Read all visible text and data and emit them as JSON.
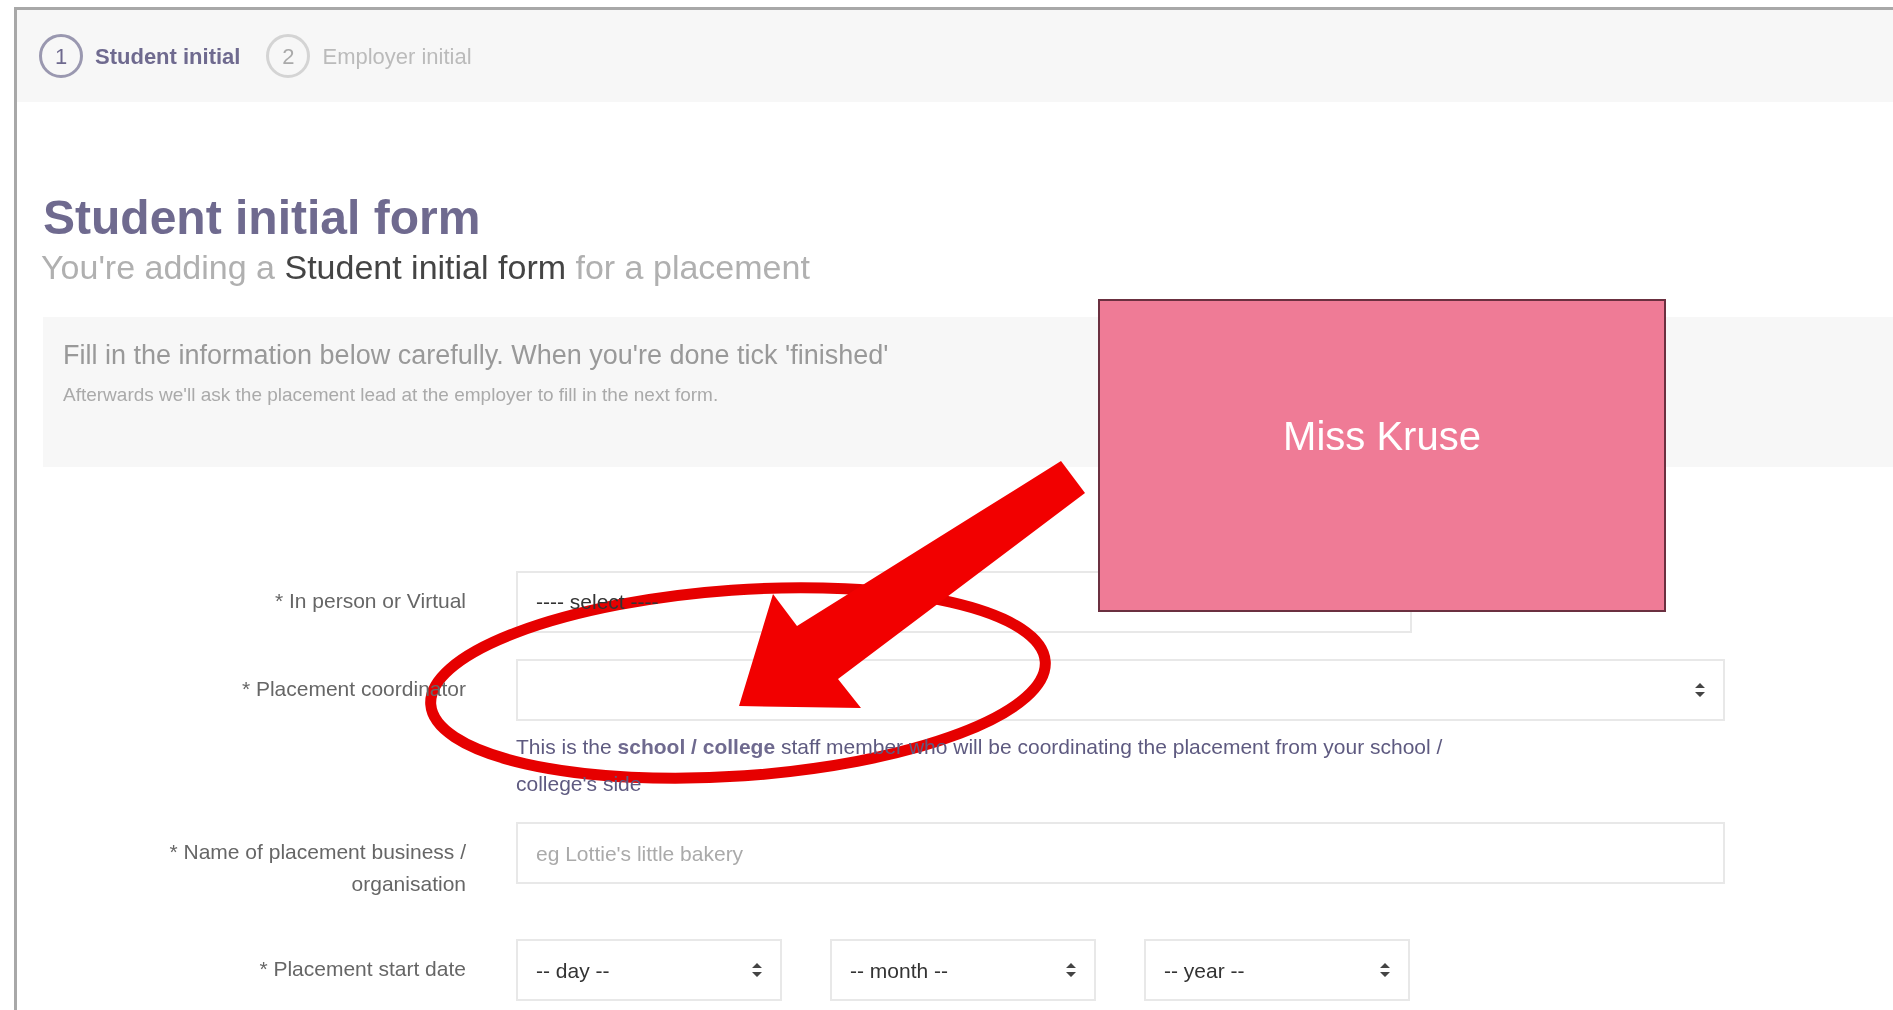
{
  "steps": [
    {
      "number": "1",
      "label": "Student initial",
      "selected": true
    },
    {
      "number": "2",
      "label": "Employer initial",
      "selected": false
    }
  ],
  "heading": "Student initial form",
  "subtitle": {
    "before": "You're adding a",
    "emphasis": "Student initial form",
    "after": "for a placement"
  },
  "info": {
    "main": "Fill in the information below carefully. When you're done tick 'finished'",
    "note": "Afterwards we'll ask the placement lead at the employer to fill in the next form."
  },
  "fields": [
    {
      "kind": "select",
      "label": "* In person or Virtual",
      "value": "---- select ----"
    },
    {
      "kind": "select",
      "label": "* Placement coordinator",
      "help": "This is the **school / college** staff member who will be coordinating the placement from your school / college's side"
    },
    {
      "kind": "text",
      "label": "* Name of placement business / organisation",
      "placeholder": "eg Lottie's little bakery"
    },
    {
      "kind": "date",
      "label": "* Placement start date",
      "parts": [
        "-- day --",
        "-- month --",
        "-- year --"
      ]
    }
  ],
  "callout": {
    "text": "Miss Kruse"
  }
}
